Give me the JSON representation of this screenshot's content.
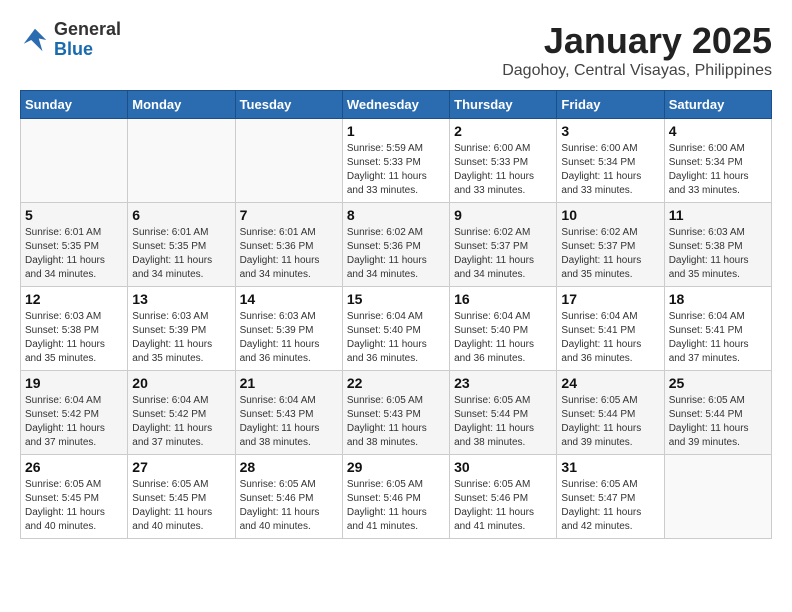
{
  "header": {
    "logo_line1": "General",
    "logo_line2": "Blue",
    "month_year": "January 2025",
    "location": "Dagohoy, Central Visayas, Philippines"
  },
  "weekdays": [
    "Sunday",
    "Monday",
    "Tuesday",
    "Wednesday",
    "Thursday",
    "Friday",
    "Saturday"
  ],
  "weeks": [
    [
      {
        "day": "",
        "sunrise": "",
        "sunset": "",
        "daylight": ""
      },
      {
        "day": "",
        "sunrise": "",
        "sunset": "",
        "daylight": ""
      },
      {
        "day": "",
        "sunrise": "",
        "sunset": "",
        "daylight": ""
      },
      {
        "day": "1",
        "sunrise": "Sunrise: 5:59 AM",
        "sunset": "Sunset: 5:33 PM",
        "daylight": "Daylight: 11 hours and 33 minutes."
      },
      {
        "day": "2",
        "sunrise": "Sunrise: 6:00 AM",
        "sunset": "Sunset: 5:33 PM",
        "daylight": "Daylight: 11 hours and 33 minutes."
      },
      {
        "day": "3",
        "sunrise": "Sunrise: 6:00 AM",
        "sunset": "Sunset: 5:34 PM",
        "daylight": "Daylight: 11 hours and 33 minutes."
      },
      {
        "day": "4",
        "sunrise": "Sunrise: 6:00 AM",
        "sunset": "Sunset: 5:34 PM",
        "daylight": "Daylight: 11 hours and 33 minutes."
      }
    ],
    [
      {
        "day": "5",
        "sunrise": "Sunrise: 6:01 AM",
        "sunset": "Sunset: 5:35 PM",
        "daylight": "Daylight: 11 hours and 34 minutes."
      },
      {
        "day": "6",
        "sunrise": "Sunrise: 6:01 AM",
        "sunset": "Sunset: 5:35 PM",
        "daylight": "Daylight: 11 hours and 34 minutes."
      },
      {
        "day": "7",
        "sunrise": "Sunrise: 6:01 AM",
        "sunset": "Sunset: 5:36 PM",
        "daylight": "Daylight: 11 hours and 34 minutes."
      },
      {
        "day": "8",
        "sunrise": "Sunrise: 6:02 AM",
        "sunset": "Sunset: 5:36 PM",
        "daylight": "Daylight: 11 hours and 34 minutes."
      },
      {
        "day": "9",
        "sunrise": "Sunrise: 6:02 AM",
        "sunset": "Sunset: 5:37 PM",
        "daylight": "Daylight: 11 hours and 34 minutes."
      },
      {
        "day": "10",
        "sunrise": "Sunrise: 6:02 AM",
        "sunset": "Sunset: 5:37 PM",
        "daylight": "Daylight: 11 hours and 35 minutes."
      },
      {
        "day": "11",
        "sunrise": "Sunrise: 6:03 AM",
        "sunset": "Sunset: 5:38 PM",
        "daylight": "Daylight: 11 hours and 35 minutes."
      }
    ],
    [
      {
        "day": "12",
        "sunrise": "Sunrise: 6:03 AM",
        "sunset": "Sunset: 5:38 PM",
        "daylight": "Daylight: 11 hours and 35 minutes."
      },
      {
        "day": "13",
        "sunrise": "Sunrise: 6:03 AM",
        "sunset": "Sunset: 5:39 PM",
        "daylight": "Daylight: 11 hours and 35 minutes."
      },
      {
        "day": "14",
        "sunrise": "Sunrise: 6:03 AM",
        "sunset": "Sunset: 5:39 PM",
        "daylight": "Daylight: 11 hours and 36 minutes."
      },
      {
        "day": "15",
        "sunrise": "Sunrise: 6:04 AM",
        "sunset": "Sunset: 5:40 PM",
        "daylight": "Daylight: 11 hours and 36 minutes."
      },
      {
        "day": "16",
        "sunrise": "Sunrise: 6:04 AM",
        "sunset": "Sunset: 5:40 PM",
        "daylight": "Daylight: 11 hours and 36 minutes."
      },
      {
        "day": "17",
        "sunrise": "Sunrise: 6:04 AM",
        "sunset": "Sunset: 5:41 PM",
        "daylight": "Daylight: 11 hours and 36 minutes."
      },
      {
        "day": "18",
        "sunrise": "Sunrise: 6:04 AM",
        "sunset": "Sunset: 5:41 PM",
        "daylight": "Daylight: 11 hours and 37 minutes."
      }
    ],
    [
      {
        "day": "19",
        "sunrise": "Sunrise: 6:04 AM",
        "sunset": "Sunset: 5:42 PM",
        "daylight": "Daylight: 11 hours and 37 minutes."
      },
      {
        "day": "20",
        "sunrise": "Sunrise: 6:04 AM",
        "sunset": "Sunset: 5:42 PM",
        "daylight": "Daylight: 11 hours and 37 minutes."
      },
      {
        "day": "21",
        "sunrise": "Sunrise: 6:04 AM",
        "sunset": "Sunset: 5:43 PM",
        "daylight": "Daylight: 11 hours and 38 minutes."
      },
      {
        "day": "22",
        "sunrise": "Sunrise: 6:05 AM",
        "sunset": "Sunset: 5:43 PM",
        "daylight": "Daylight: 11 hours and 38 minutes."
      },
      {
        "day": "23",
        "sunrise": "Sunrise: 6:05 AM",
        "sunset": "Sunset: 5:44 PM",
        "daylight": "Daylight: 11 hours and 38 minutes."
      },
      {
        "day": "24",
        "sunrise": "Sunrise: 6:05 AM",
        "sunset": "Sunset: 5:44 PM",
        "daylight": "Daylight: 11 hours and 39 minutes."
      },
      {
        "day": "25",
        "sunrise": "Sunrise: 6:05 AM",
        "sunset": "Sunset: 5:44 PM",
        "daylight": "Daylight: 11 hours and 39 minutes."
      }
    ],
    [
      {
        "day": "26",
        "sunrise": "Sunrise: 6:05 AM",
        "sunset": "Sunset: 5:45 PM",
        "daylight": "Daylight: 11 hours and 40 minutes."
      },
      {
        "day": "27",
        "sunrise": "Sunrise: 6:05 AM",
        "sunset": "Sunset: 5:45 PM",
        "daylight": "Daylight: 11 hours and 40 minutes."
      },
      {
        "day": "28",
        "sunrise": "Sunrise: 6:05 AM",
        "sunset": "Sunset: 5:46 PM",
        "daylight": "Daylight: 11 hours and 40 minutes."
      },
      {
        "day": "29",
        "sunrise": "Sunrise: 6:05 AM",
        "sunset": "Sunset: 5:46 PM",
        "daylight": "Daylight: 11 hours and 41 minutes."
      },
      {
        "day": "30",
        "sunrise": "Sunrise: 6:05 AM",
        "sunset": "Sunset: 5:46 PM",
        "daylight": "Daylight: 11 hours and 41 minutes."
      },
      {
        "day": "31",
        "sunrise": "Sunrise: 6:05 AM",
        "sunset": "Sunset: 5:47 PM",
        "daylight": "Daylight: 11 hours and 42 minutes."
      },
      {
        "day": "",
        "sunrise": "",
        "sunset": "",
        "daylight": ""
      }
    ]
  ]
}
